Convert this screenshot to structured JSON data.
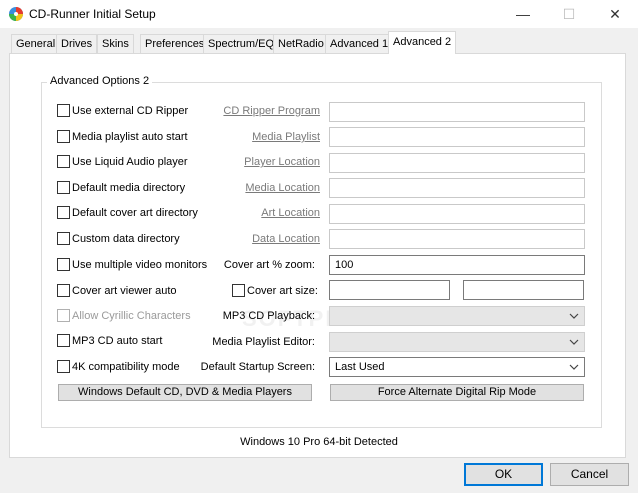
{
  "window": {
    "title": "CD-Runner Initial Setup",
    "min_glyph": "—",
    "max_glyph": "☐",
    "close_glyph": "✕"
  },
  "tabs": [
    "General",
    "Drives",
    "Skins",
    "Preferences",
    "Spectrum/EQ",
    "NetRadio",
    "Advanced 1",
    "Advanced 2"
  ],
  "active_tab": "Advanced 2",
  "group": {
    "label": "Advanced Options 2"
  },
  "checkboxes": [
    {
      "label": "Use external CD Ripper",
      "checked": false
    },
    {
      "label": "Media playlist auto start",
      "checked": false
    },
    {
      "label": "Use Liquid Audio player",
      "checked": false
    },
    {
      "label": "Default media directory",
      "checked": false
    },
    {
      "label": "Default cover art directory",
      "checked": false
    },
    {
      "label": "Custom data directory",
      "checked": false
    },
    {
      "label": "Use multiple video monitors",
      "checked": false
    },
    {
      "label": "Cover art viewer auto",
      "checked": false
    },
    {
      "label": "Allow Cyrillic Characters",
      "checked": false,
      "disabled": true
    },
    {
      "label": "MP3 CD auto start",
      "checked": false
    },
    {
      "label": "4K compatibility mode",
      "checked": false
    }
  ],
  "path_fields": [
    {
      "link": "CD Ripper Program",
      "value": ""
    },
    {
      "link": "Media Playlist",
      "value": ""
    },
    {
      "link": "Player Location",
      "value": ""
    },
    {
      "link": "Media Location",
      "value": ""
    },
    {
      "link": "Art Location",
      "value": ""
    },
    {
      "link": "Data Location",
      "value": ""
    }
  ],
  "cover_zoom": {
    "label": "Cover art % zoom:",
    "value": "100"
  },
  "cover_size": {
    "label": "Cover art size:",
    "checked": false,
    "width": "",
    "height": ""
  },
  "mp3_playback": {
    "label": "MP3 CD Playback:",
    "value": ""
  },
  "playlist_editor": {
    "label": "Media Playlist Editor:",
    "value": ""
  },
  "startup_screen": {
    "label": "Default Startup Screen:",
    "value": "Last Used"
  },
  "buttons": {
    "windows_default": "Windows Default CD, DVD & Media Players",
    "force_rip": "Force Alternate Digital Rip Mode",
    "ok": "OK",
    "cancel": "Cancel"
  },
  "status": "Windows 10 Pro 64-bit Detected",
  "watermark": "SOFTPEDIA",
  "colors": {
    "link": "#7a7a7a",
    "ok_border": "#0078d7"
  }
}
